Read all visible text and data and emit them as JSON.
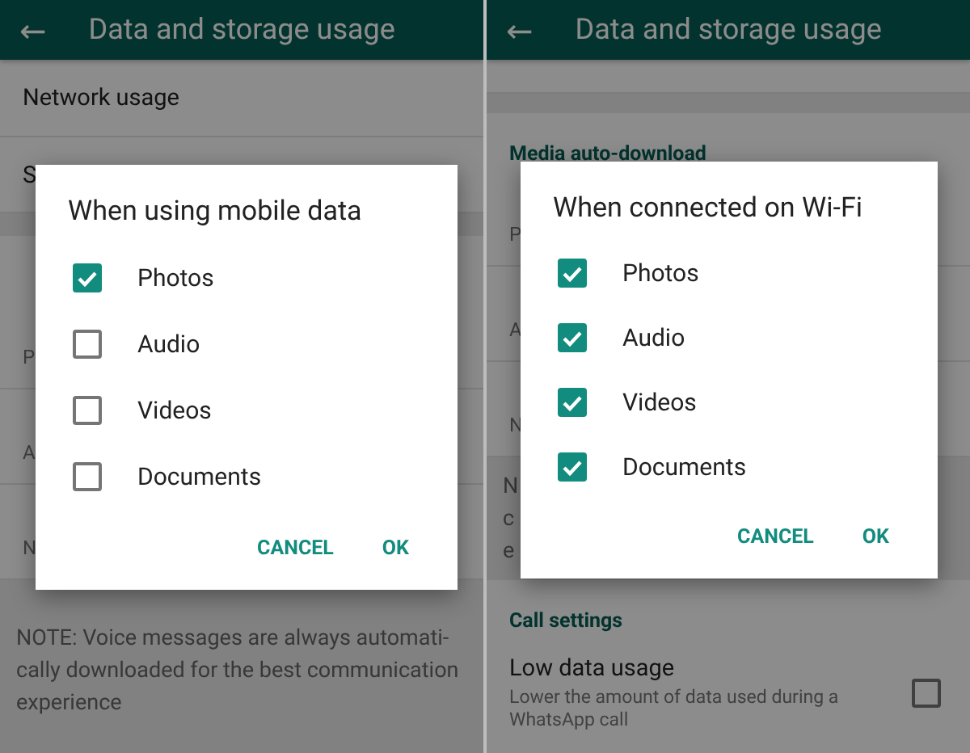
{
  "panels": [
    {
      "header": {
        "back": "←",
        "title": "Data and storage usage"
      },
      "items": [
        {
          "kind": "row",
          "title": "Network usage"
        },
        {
          "kind": "row",
          "title": "S"
        },
        {
          "kind": "gap"
        },
        {
          "kind": "section"
        },
        {
          "kind": "row",
          "subtitle": "P"
        },
        {
          "kind": "row",
          "subtitle": "A"
        },
        {
          "kind": "row",
          "subtitle": "N"
        },
        {
          "kind": "note",
          "lines": [
            "NOTE: Voice messages are always automati-",
            "cally downloaded for the best communication",
            "experience"
          ]
        }
      ],
      "dialog": {
        "title": "When using mobile data",
        "options": [
          {
            "label": "Photos",
            "checked": true
          },
          {
            "label": "Audio",
            "checked": false
          },
          {
            "label": "Videos",
            "checked": false
          },
          {
            "label": "Documents",
            "checked": false
          }
        ],
        "buttons": [
          "CANCEL",
          "OK"
        ]
      }
    },
    {
      "header": {
        "back": "←",
        "title": "Data and storage usage"
      },
      "items": [
        {
          "kind": "sliver"
        },
        {
          "kind": "gap"
        },
        {
          "kind": "section",
          "label": "Media auto-download"
        },
        {
          "kind": "row",
          "subtitle": "P"
        },
        {
          "kind": "row",
          "subtitle": "A"
        },
        {
          "kind": "row",
          "subtitle": "N"
        },
        {
          "kind": "note",
          "lines": [
            "N",
            "c",
            "e"
          ]
        },
        {
          "kind": "section",
          "label": "Call settings"
        },
        {
          "kind": "check_row",
          "title": "Low data usage",
          "subtitle": "Lower the amount of data used during a WhatsApp call",
          "checked": false
        }
      ],
      "dialog": {
        "title": "When connected on Wi-Fi",
        "options": [
          {
            "label": "Photos",
            "checked": true
          },
          {
            "label": "Audio",
            "checked": true
          },
          {
            "label": "Videos",
            "checked": true
          },
          {
            "label": "Documents",
            "checked": true
          }
        ],
        "buttons": [
          "CANCEL",
          "OK"
        ]
      }
    }
  ]
}
